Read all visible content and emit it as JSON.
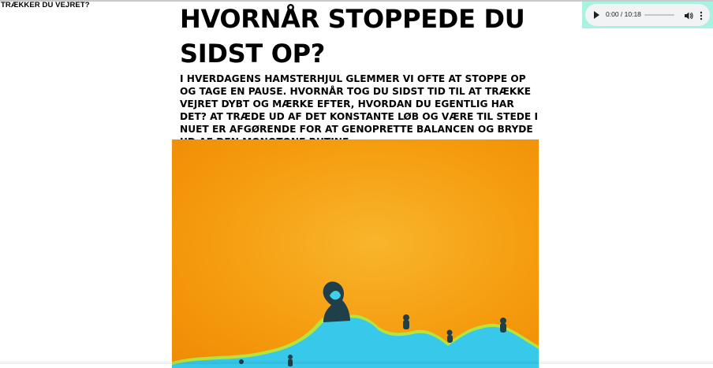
{
  "site": {
    "title": "TRÆKKER DU VEJRET?"
  },
  "article": {
    "headline": "HVORNÅR STOPPEDE DU SIDST OP?",
    "lead": "I HVERDAGENS HAMSTERHJUL GLEMMER VI OFTE AT STOPPE OP OG TAGE EN PAUSE. HVORNÅR TOG DU SIDST TID TIL AT TRÆKKE VEJRET DYBT OG MÆRKE EFTER, HVORDAN DU EGENTLIG HAR DET? AT TRÆDE UD AF DET KONSTANTE LØB OG VÆRE TIL STEDE I NUET ER AFGØRENDE FOR AT GENOPRETTE BALANCEN OG BRYDE UD AF DEN MONOTONE RUTINE."
  },
  "audio_player": {
    "time": "0:00 / 10:18",
    "progress_fraction": 0,
    "icons": [
      "play-icon",
      "volume-icon",
      "more-options-icon"
    ]
  },
  "hero_image": {
    "colors": {
      "sky": "#f59a0c",
      "sky_light": "#f7b82a",
      "hills": "#38c9ea",
      "outline": "#b8e33b",
      "figures": "#1f3f4a"
    }
  }
}
